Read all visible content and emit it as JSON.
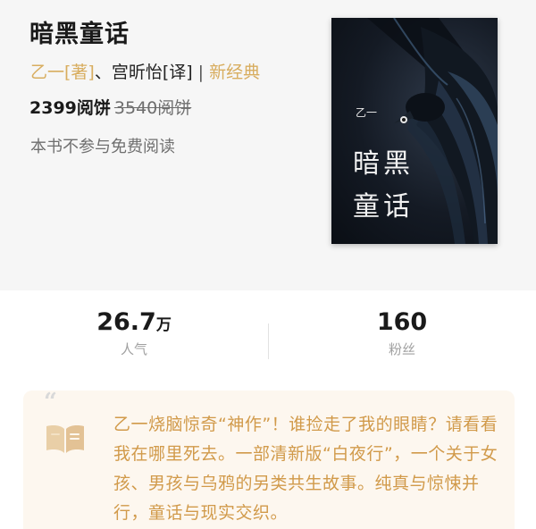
{
  "book": {
    "title": "暗黑童话",
    "author": "乙一[著]",
    "separator_comma": "、",
    "translator": "宫昕怡[译]",
    "divider": "|",
    "series": "新经典",
    "price_current": "2399阅饼",
    "price_original": "3540阅饼",
    "note": "本书不参与免费阅读"
  },
  "cover": {
    "title_line1": "暗黑",
    "title_line2": "童话",
    "author": "乙一"
  },
  "stats": {
    "popularity_value": "26.7",
    "popularity_unit": "万",
    "popularity_label": "人气",
    "fans_value": "160",
    "fans_label": "粉丝"
  },
  "intro": {
    "quote_mark": "“",
    "text": "乙一烧脑惊奇“神作”！谁捡走了我的眼睛？请看看我在哪里死去。一部清新版“白夜行”，一个关于女孩、男孩与乌鸦的另类共生故事。纯真与惊悚并行，童话与现实交织。"
  },
  "colors": {
    "accent_gold": "#d8ad5f",
    "intro_text": "#d19a4a",
    "header_bg": "#f6f6f6"
  }
}
